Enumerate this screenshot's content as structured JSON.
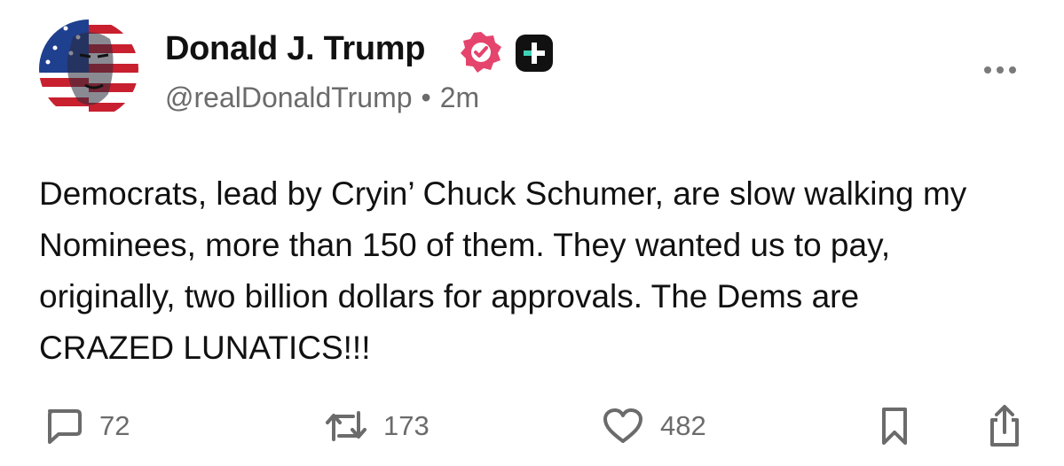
{
  "author": {
    "display_name": "Donald J. Trump",
    "handle": "@realDonaldTrump",
    "separator": "•",
    "time_ago": "2m",
    "badges": [
      "verified-badge-icon",
      "plus-badge-icon"
    ]
  },
  "post": {
    "text": "Democrats, lead by Cryin’ Chuck Schumer, are slow walking my Nominees, more than 150 of them. They wanted us to pay, originally, two billion dollars for approvals. The Dems are CRAZED LUNATICS!!!"
  },
  "actions": {
    "reply_count": "72",
    "repost_count": "173",
    "like_count": "482",
    "icons": [
      "reply-icon",
      "repost-icon",
      "heart-icon",
      "bookmark-icon",
      "share-icon",
      "more-icon"
    ]
  },
  "colors": {
    "text": "#111111",
    "muted": "#6b6b6b",
    "verified": "#e5446d",
    "plus_badge": "#111111",
    "plus_accent": "#3fd1b5"
  }
}
